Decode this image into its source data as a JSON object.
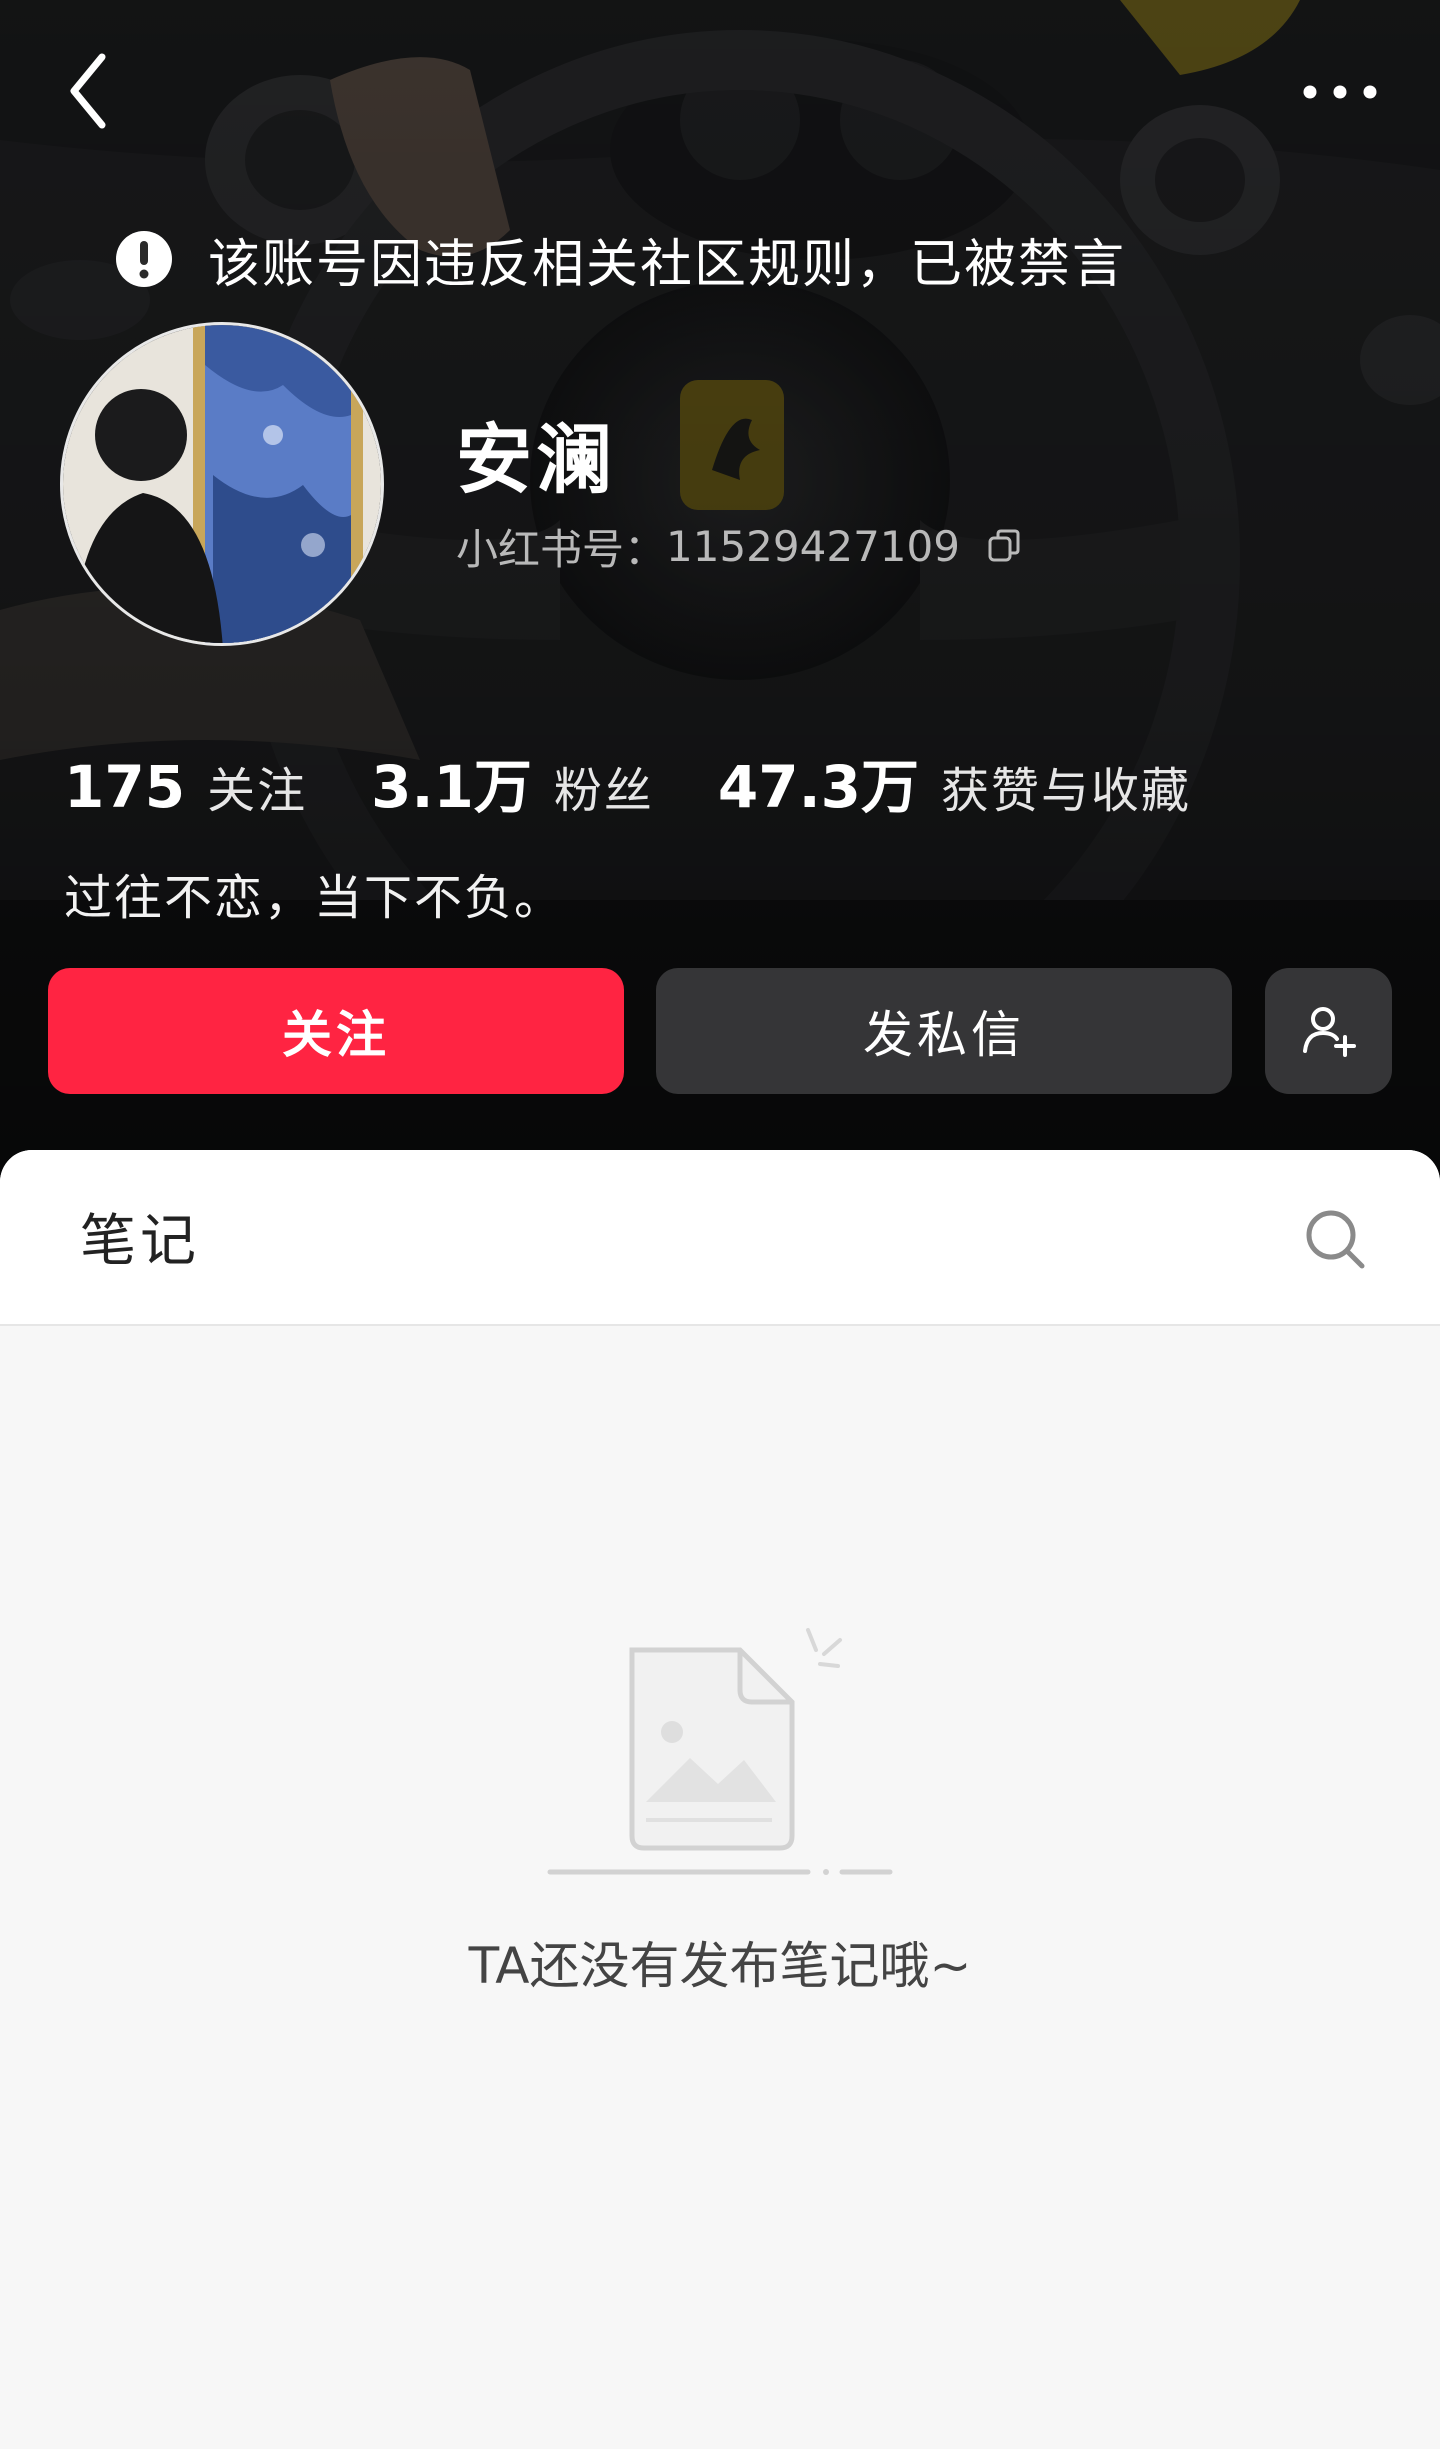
{
  "header": {
    "ban_notice": "该账号因违反相关社区规则，已被禁言"
  },
  "profile": {
    "username": "安澜",
    "id_label": "小红书号：",
    "id_value": "11529427109",
    "bio": "过往不恋，当下不负。"
  },
  "stats": {
    "following_count": "175",
    "following_label": "关注",
    "followers_count": "3.1万",
    "followers_label": "粉丝",
    "likes_count": "47.3万",
    "likes_label": "获赞与收藏"
  },
  "actions": {
    "follow_label": "关注",
    "message_label": "发私信"
  },
  "tabs": {
    "notes_label": "笔记"
  },
  "empty_state": {
    "message": "TA还没有发布笔记哦~"
  },
  "colors": {
    "brand_red": "#ff2442",
    "header_bg": "#1d1e20",
    "content_bg": "#f7f7f7"
  },
  "icons": {
    "back": "chevron-left-icon",
    "more": "more-dots-icon",
    "notice": "exclamation-circle-icon",
    "copy": "copy-icon",
    "add_friend": "add-user-icon",
    "search": "search-icon",
    "empty": "empty-document-icon"
  }
}
